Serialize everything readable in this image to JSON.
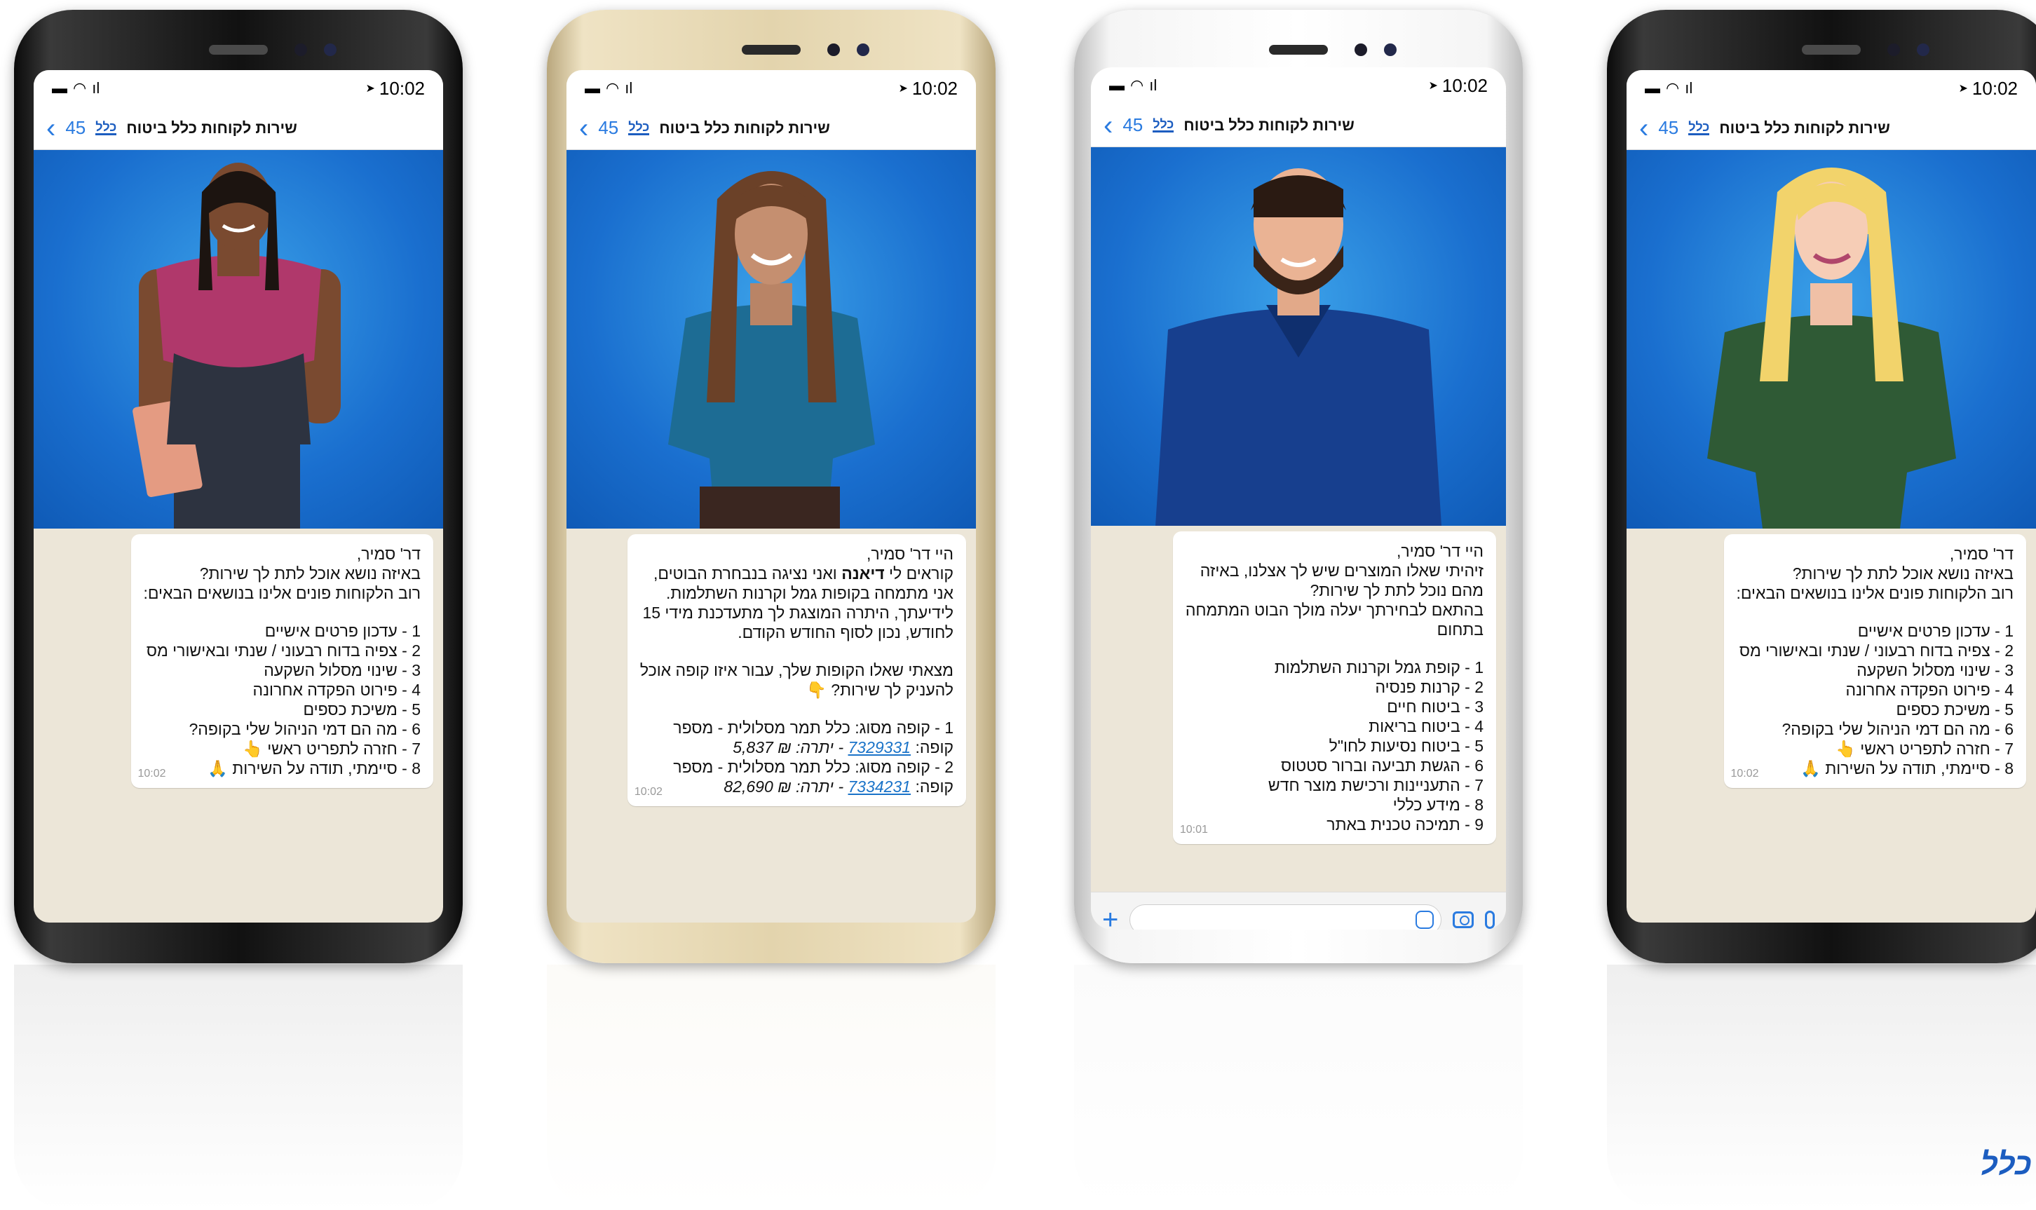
{
  "status": {
    "time": "10:02",
    "signal": "ıl",
    "location_glyph": "➤"
  },
  "header": {
    "title": "שירות לקוחות כלל ביטוח",
    "count": "45",
    "logo": "כלל"
  },
  "phones": [
    {
      "style": "black",
      "bubble": {
        "lines": [
          "דר' סמיר,",
          "באיזה נושא אוכל לתת לך שירות?",
          "רוב הלקוחות פונים אלינו בנושאים הבאים:"
        ],
        "options": [
          "1 - עדכון פרטים אישיים",
          "2 - צפיה בדוח רבעוני / שנתי ובאישורי מס",
          "3 - שינוי מסלול השקעה",
          "4 - פירוט הפקדה אחרונה",
          "5 - משיכת כספים",
          "6 - מה הם דמי הניהול שלי בקופה?",
          "7 - חזרה לתפריט ראשי 👆",
          "8 - סיימתי, תודה על השירות 🙏"
        ],
        "time": "10:02"
      }
    },
    {
      "style": "gold",
      "bubble": {
        "l1": "היי דר' סמיר,",
        "l2a": "קוראים לי ",
        "l2b": "דיאנה",
        "l2c": " ואני נציגה בנבחרת הבוטים,",
        "l3": "אני מתמחה בקופות גמל וקרנות השתלמות.",
        "l4": "לידיעתך, היתרה המוצגת לך מתעדכנת מידי 15",
        "l5": "לחודש, נכון לסוף החודש הקודם.",
        "l6": "מצאתי שאלו הקופות שלך, עבור איזו קופה אוכל",
        "l7": "להעניק לך שירות? 👇",
        "f1a": "1 - קופה מסוג: כלל תמר מסלולית - מספר",
        "f1b": "קופה: ",
        "f1link": "7329331",
        "f1c": " - יתרה: ₪ 5,837",
        "f2a": "2 - קופה מסוג: כלל תמר מסלולית - מספר",
        "f2b": "קופה: ",
        "f2link": "7334231",
        "f2c": " - יתרה: ₪ 82,690",
        "time": "10:02"
      }
    },
    {
      "style": "white",
      "bubble": {
        "lines": [
          "היי דר' סמיר,",
          "זיהיתי שאלו המוצרים שיש לך אצלנו, באיזה",
          "מהם נוכל לתת לך שירות?",
          "בהתאם לבחירתך יעלה מולך הבוט המתמחה",
          "בתחום"
        ],
        "options": [
          "1 - קופת גמל וקרנות השתלמות",
          "2 - קרנות פנסיה",
          "3 - ביטוח חיים",
          "4 - ביטוח בריאות",
          "5 - ביטוח נסיעות לחו\"ל",
          "6 - הגשת תביעה וברור סטטוס",
          "7 - התעניינות ורכישת מוצר חדש",
          "8 - מידע כללי",
          "9 - תמיכה טכנית באתר"
        ],
        "time": "10:01"
      }
    },
    {
      "style": "black",
      "bubble": {
        "lines": [
          "דר' סמיר,",
          "באיזה נושא אוכל לתת לך שירות?",
          "רוב הלקוחות פונים אלינו בנושאים הבאים:"
        ],
        "options": [
          "1 - עדכון פרטים אישיים",
          "2 - צפיה בדוח רבעוני / שנתי ובאישורי מס",
          "3 - שינוי מסלול השקעה",
          "4 - פירוט הפקדה אחרונה",
          "5 - משיכת כספים",
          "6 - מה הם דמי הניהול שלי בקופה?",
          "7 - חזרה לתפריט ראשי 👆",
          "8 - סיימתי, תודה על השירות 🙏"
        ],
        "time": "10:02"
      }
    }
  ],
  "colors": {
    "accent": "#2a7be0",
    "brand": "#1c5dc0",
    "hero": "#1a6fcf",
    "chat_bg": "#ece6d8"
  }
}
